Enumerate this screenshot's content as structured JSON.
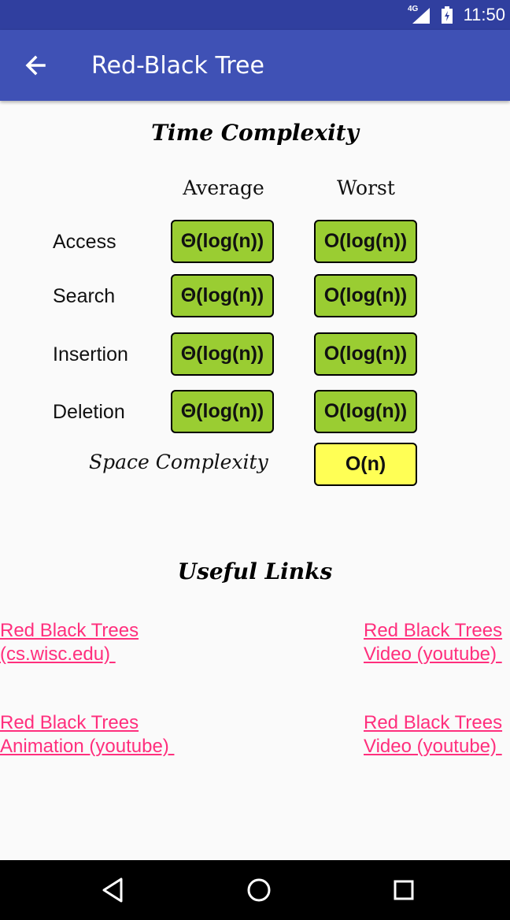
{
  "status_bar": {
    "network": "4G",
    "time": "11:50"
  },
  "app_bar": {
    "title": "Red-Black Tree",
    "back_icon": "arrow-back-icon"
  },
  "time_complexity": {
    "title": "Time Complexity",
    "columns": [
      "Average",
      "Worst"
    ],
    "rows": [
      {
        "label": "Access",
        "average": "Θ(log(n))",
        "worst": "O(log(n))"
      },
      {
        "label": "Search",
        "average": "Θ(log(n))",
        "worst": "O(log(n))"
      },
      {
        "label": "Insertion",
        "average": "Θ(log(n))",
        "worst": "O(log(n))"
      },
      {
        "label": "Deletion",
        "average": "Θ(log(n))",
        "worst": "O(log(n))"
      }
    ],
    "space_label": "Space Complexity",
    "space_value": "O(n)",
    "colors": {
      "good": "#9acd32",
      "fair": "#ffff55"
    }
  },
  "useful_links": {
    "title": "Useful Links",
    "links": [
      {
        "text": "Red Black Trees\n(cs.wisc.edu) "
      },
      {
        "text": "Red Black Trees\nVideo (youtube) "
      },
      {
        "text": "Red Black Trees\nAnimation (youtube) "
      },
      {
        "text": "Red Black Trees\nVideo (youtube) "
      }
    ],
    "link_color": "#ff2f7d"
  },
  "nav_bar": {
    "icons": [
      "back-triangle-icon",
      "home-circle-icon",
      "recents-square-icon"
    ]
  }
}
